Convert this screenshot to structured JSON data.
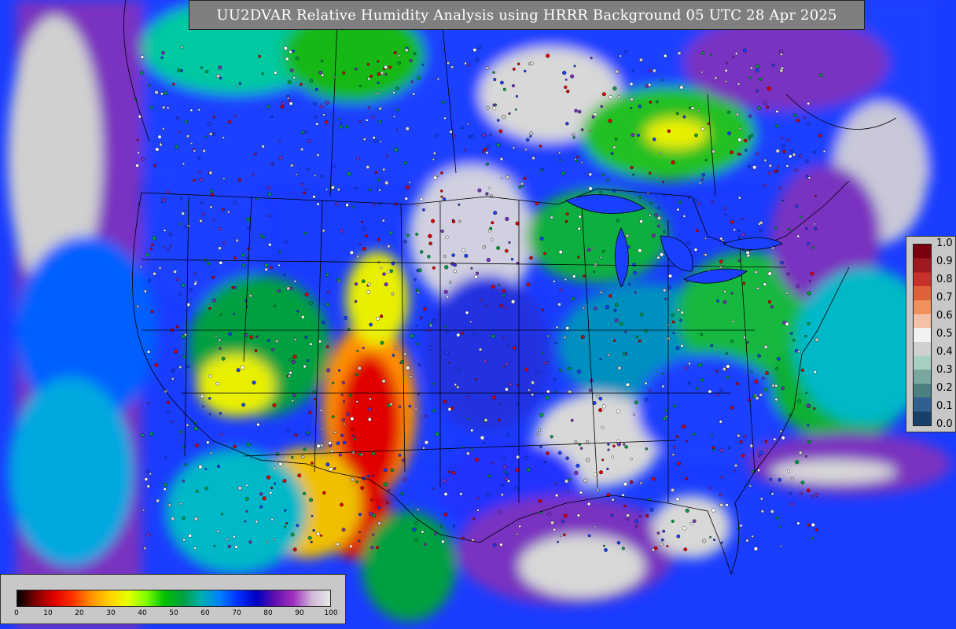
{
  "title": "UU2DVAR Relative Humidity Analysis using HRRR Background 05 UTC 28 Apr 2025",
  "colorbar_right": {
    "ticks": [
      "1.0",
      "0.9",
      "0.8",
      "0.7",
      "0.6",
      "0.5",
      "0.4",
      "0.3",
      "0.2",
      "0.1",
      "0.0"
    ],
    "colors_top_to_bottom": [
      "#7a0010",
      "#a01820",
      "#c8302a",
      "#e0603a",
      "#f0905a",
      "#f5c0a8",
      "#f2f2f2",
      "#d0d0d0",
      "#a8d0c0",
      "#78a8a0",
      "#4c8080",
      "#306090",
      "#18406a"
    ]
  },
  "colorbar_bottom": {
    "ticks": [
      "0",
      "10",
      "20",
      "30",
      "40",
      "50",
      "60",
      "70",
      "80",
      "90",
      "100"
    ],
    "gradient_stops": [
      "#000000",
      "#800000",
      "#e00000",
      "#ff3000",
      "#ff9000",
      "#ffd000",
      "#e8ff00",
      "#80ff00",
      "#00c000",
      "#00a040",
      "#00b0b0",
      "#0080ff",
      "#0030ff",
      "#0000c0",
      "#6010b0",
      "#a030c0",
      "#d0b8d8",
      "#e8e8e8"
    ]
  },
  "map": {
    "description_colors": {
      "ocean_high": "#d0d0d0",
      "purple": "#8a2bb0",
      "blue": "#1a3cff",
      "cyan": "#00b4c8",
      "green": "#18c018",
      "yellow": "#e8f000",
      "orange": "#ff9000",
      "red": "#e00000",
      "white": "#e8e8e8"
    }
  }
}
